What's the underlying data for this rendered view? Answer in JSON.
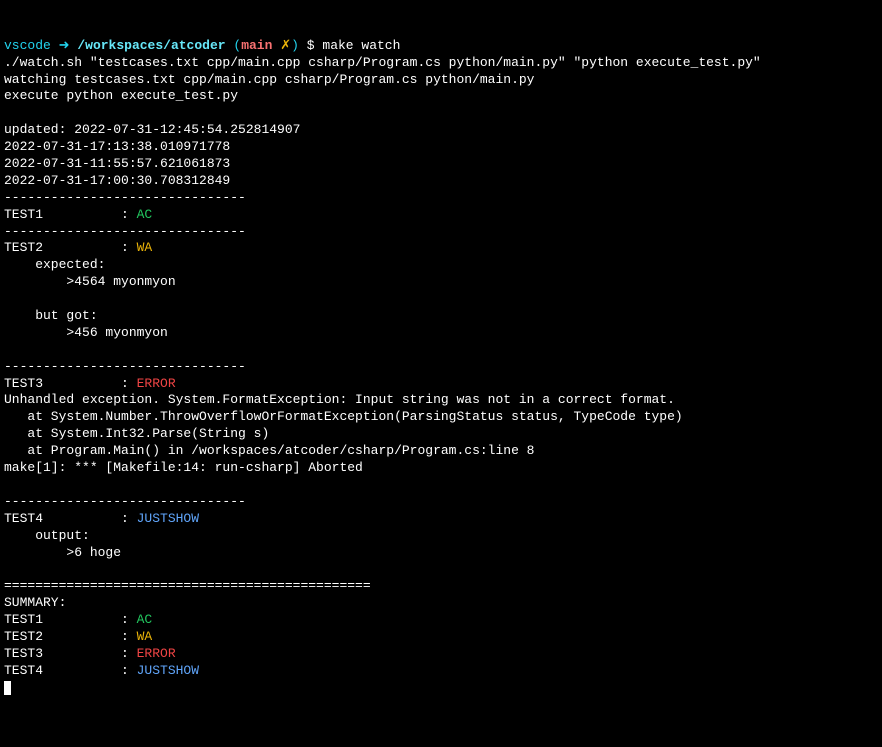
{
  "prompt": {
    "user": "vscode",
    "arrow": "➜",
    "path": "/workspaces/atcoder",
    "branch_open": "(",
    "branch_name": "main",
    "dirty": "✗",
    "branch_close": ")",
    "dollar": "$",
    "command": "make watch"
  },
  "header": {
    "watch_sh": "./watch.sh \"testcases.txt cpp/main.cpp csharp/Program.cs python/main.py\" \"python execute_test.py\"",
    "watching": "watching testcases.txt cpp/main.cpp csharp/Program.cs python/main.py",
    "execute": "execute python execute_test.py",
    "blank": "",
    "updated": "updated: 2022-07-31-12:45:54.252814907",
    "ts1": "2022-07-31-17:13:38.010971778",
    "ts2": "2022-07-31-11:55:57.621061873",
    "ts3": "2022-07-31-17:00:30.708312849"
  },
  "sep_dash": "-------------------------------",
  "tests": {
    "t1": {
      "label": "TEST1          : ",
      "result": "AC"
    },
    "t2": {
      "label": "TEST2          : ",
      "result": "WA",
      "expected_lbl": "    expected:",
      "expected_val": "        >4564 myonmyon",
      "butgot_lbl": "    but got:",
      "butgot_val": "        >456 myonmyon"
    },
    "t3": {
      "label": "TEST3          : ",
      "result": "ERROR",
      "err1": "Unhandled exception. System.FormatException: Input string was not in a correct format.",
      "err2": "   at System.Number.ThrowOverflowOrFormatException(ParsingStatus status, TypeCode type)",
      "err3": "   at System.Int32.Parse(String s)",
      "err4": "   at Program.Main() in /workspaces/atcoder/csharp/Program.cs:line 8",
      "err5": "make[1]: *** [Makefile:14: run-csharp] Aborted"
    },
    "t4": {
      "label": "TEST4          : ",
      "result": "JUSTSHOW",
      "output_lbl": "    output:",
      "output_val": "        >6 hoge"
    }
  },
  "summary": {
    "sep_eq": "===============================================",
    "title": "SUMMARY:",
    "s1": {
      "label": "TEST1          : ",
      "result": "AC"
    },
    "s2": {
      "label": "TEST2          : ",
      "result": "WA"
    },
    "s3": {
      "label": "TEST3          : ",
      "result": "ERROR"
    },
    "s4": {
      "label": "TEST4          : ",
      "result": "JUSTSHOW"
    }
  }
}
